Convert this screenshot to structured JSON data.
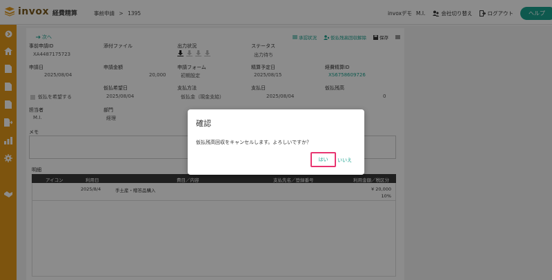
{
  "header": {
    "logo_text": "invox",
    "logo_sub": "経費精算",
    "breadcrumb": [
      "事前申請",
      ">",
      "1395"
    ],
    "user_org": "invoxデモ",
    "user_name": "M.I.",
    "switch_company": "会社切り替え",
    "logout": "ログアウト",
    "help": "ヘルプ"
  },
  "toolbar": {
    "next": "次へ",
    "approval_status": "承認状況",
    "cancel_advance": "仮払残高回収解除",
    "save": "保存"
  },
  "fields": {
    "request_id_label": "事前申請ID",
    "request_id_value": "XA4487175723",
    "attachment_label": "添付ファイル",
    "output_status_label": "出力状況",
    "status_label": "ステータス",
    "status_value": "出力待ち",
    "request_date_label": "申請日",
    "request_date_value": "2025/08/04",
    "request_amount_label": "申請金額",
    "request_amount_value": "20,000",
    "request_form_label": "申請フォーム",
    "request_form_value": "初期設定",
    "settle_date_label": "精算予定日",
    "settle_date_value": "2025/08/15",
    "expense_id_label": "経費精算ID",
    "expense_id_value": "XS6758609726",
    "advance_date_label": "仮払希望日",
    "advance_date_value": "2025/08/04",
    "payment_method_label": "支払方法",
    "payment_method_value": "仮払金（現金支給）",
    "payment_date_label": "支払日",
    "payment_date_value": "2025/08/04",
    "advance_balance_label": "仮払残高",
    "advance_balance_value": "0",
    "advance_checkbox_label": "仮払を希望する",
    "person_label": "担当者",
    "person_value": "M.I.",
    "dept_label": "部門",
    "dept_value": "経理",
    "memo_label": "メモ"
  },
  "details": {
    "label": "明細",
    "columns": [
      "アイコン",
      "利用日",
      "費目／内容",
      "支払先名／登録番号",
      "利用金額／税区分"
    ],
    "rows": [
      {
        "date": "2025/8/4",
        "item": "手土産・贈答品購入",
        "payee": "",
        "amount": "¥ 20,000",
        "tax": "10%"
      }
    ]
  },
  "dialog": {
    "title": "確認",
    "message": "仮払残高回収をキャンセルします。よろしいですか？",
    "yes": "はい",
    "no": "いいえ"
  },
  "colors": {
    "sidebar": "#e39a1a",
    "accent": "#1aa28f",
    "highlight": "#e8336f"
  }
}
